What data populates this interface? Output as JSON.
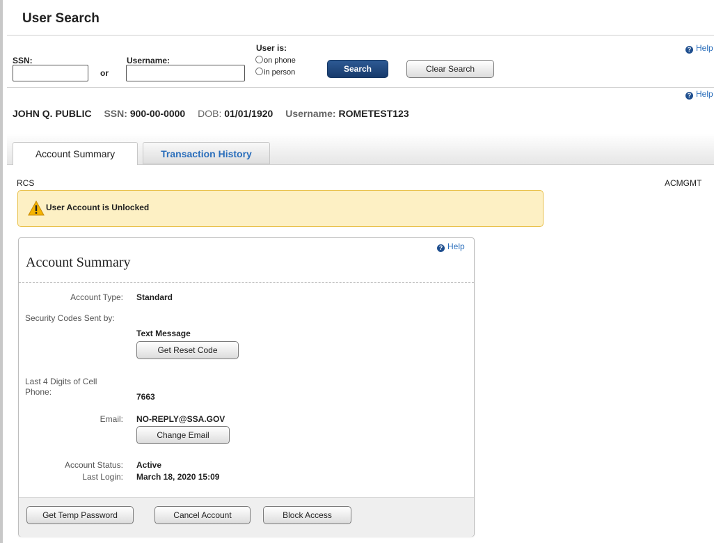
{
  "page_title": "User Search",
  "search": {
    "ssn_label": "SSN:",
    "ssn_value": "",
    "or_label": "or",
    "username_label": "Username:",
    "username_value": "",
    "user_is_label": "User is:",
    "option_phone": "on phone",
    "option_person": "in person",
    "search_button": "Search",
    "clear_button": "Clear Search"
  },
  "help_label": "Help",
  "user": {
    "name": "JOHN Q. PUBLIC",
    "ssn_label": "SSN:",
    "ssn": "900-00-0000",
    "dob_label": "DOB:",
    "dob": "01/01/1920",
    "username_label": "Username:",
    "username": "ROMETEST123"
  },
  "tabs": [
    {
      "label": "Account Summary",
      "active": true
    },
    {
      "label": "Transaction History",
      "active": false
    }
  ],
  "section_left": "RCS",
  "section_right": "ACMGMT",
  "alert": {
    "icon": "warning-icon",
    "text": "User Account is Unlocked"
  },
  "summary": {
    "title": "Account Summary",
    "account_type_label": "Account Type:",
    "account_type": "Standard",
    "security_label": "Security Codes Sent by:",
    "security_value": "Text Message",
    "reset_button": "Get Reset Code",
    "cell_label": "Last 4 Digits of Cell Phone:",
    "cell_value": "7663",
    "email_label": "Email:",
    "email_value": "NO-REPLY@SSA.GOV",
    "change_email_button": "Change Email",
    "status_label": "Account Status:",
    "status_value": "Active",
    "last_login_label": "Last Login:",
    "last_login_value": "March 18, 2020 15:09",
    "temp_password_button": "Get Temp Password",
    "cancel_button": "Cancel Account",
    "block_button": "Block Access"
  },
  "colors": {
    "accent": "#1a4780",
    "link": "#2a6ebb",
    "alert_bg": "#fdf0c4",
    "alert_border": "#e8c04a"
  }
}
